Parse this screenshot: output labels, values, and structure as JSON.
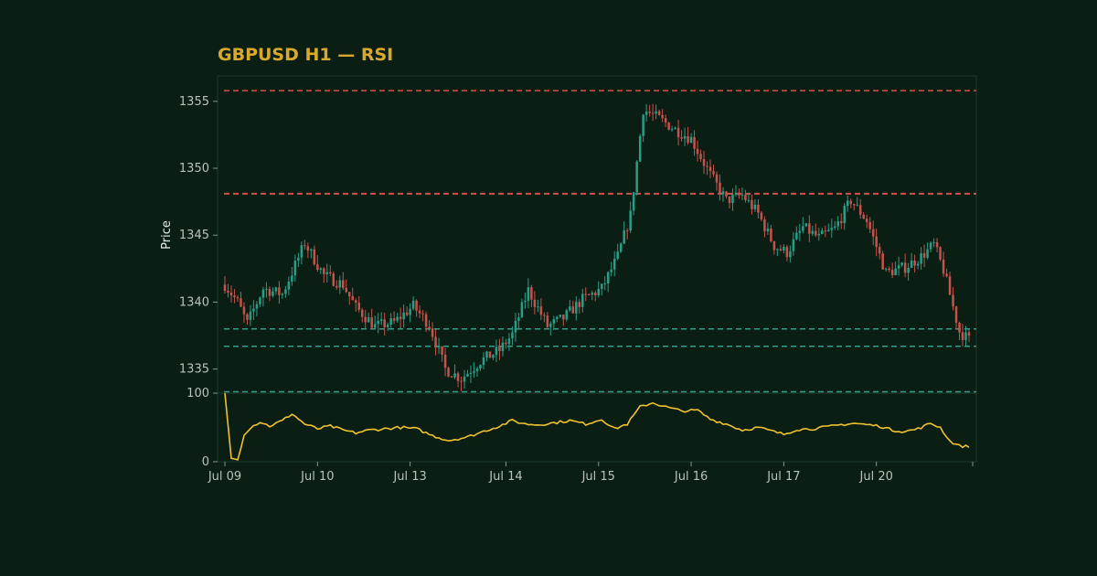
{
  "chart_data": {
    "type": "candlestick",
    "title": "GBPUSD H1 — RSI",
    "price_panel": {
      "ylabel": "Price",
      "yticks": [
        1335,
        1340,
        1345,
        1350,
        1355
      ],
      "ylim": [
        1333.2,
        1356.9
      ],
      "resistance_levels": [
        1355.8,
        1348.1
      ],
      "support_levels": [
        1338.0,
        1336.7,
        1333.3
      ],
      "series_anchors": [
        [
          0,
          1341.3
        ],
        [
          4,
          1340.0
        ],
        [
          7,
          1338.4
        ],
        [
          12,
          1341.0
        ],
        [
          18,
          1340.6
        ],
        [
          25,
          1344.4
        ],
        [
          31,
          1342.0
        ],
        [
          37,
          1341.3
        ],
        [
          41,
          1339.6
        ],
        [
          47,
          1338.2
        ],
        [
          53,
          1338.5
        ],
        [
          59,
          1339.7
        ],
        [
          64,
          1338.3
        ],
        [
          69,
          1335.0
        ],
        [
          74,
          1334.3
        ],
        [
          80,
          1335.6
        ],
        [
          86,
          1336.4
        ],
        [
          90,
          1337.6
        ],
        [
          95,
          1340.9
        ],
        [
          101,
          1338.2
        ],
        [
          106,
          1338.8
        ],
        [
          112,
          1340.2
        ],
        [
          118,
          1341.0
        ],
        [
          123,
          1343.4
        ],
        [
          127,
          1346.5
        ],
        [
          131,
          1354.4
        ],
        [
          136,
          1353.7
        ],
        [
          141,
          1352.9
        ],
        [
          146,
          1352.2
        ],
        [
          152,
          1349.5
        ],
        [
          157,
          1347.6
        ],
        [
          162,
          1348.0
        ],
        [
          167,
          1346.6
        ],
        [
          172,
          1344.2
        ],
        [
          176,
          1343.7
        ],
        [
          181,
          1345.6
        ],
        [
          186,
          1344.8
        ],
        [
          191,
          1345.5
        ],
        [
          196,
          1347.6
        ],
        [
          201,
          1346.1
        ],
        [
          207,
          1342.2
        ],
        [
          213,
          1342.6
        ],
        [
          218,
          1343.4
        ],
        [
          222,
          1344.3
        ],
        [
          225,
          1342.4
        ],
        [
          230,
          1337.8
        ],
        [
          233,
          1337.2
        ]
      ]
    },
    "rsi_panel": {
      "yticks": [
        0,
        100
      ],
      "ylim": [
        0,
        100
      ],
      "series_anchors": [
        [
          0,
          100
        ],
        [
          2,
          5
        ],
        [
          4,
          3
        ],
        [
          6,
          40
        ],
        [
          8,
          50
        ],
        [
          11,
          58
        ],
        [
          14,
          52
        ],
        [
          18,
          60
        ],
        [
          21,
          70
        ],
        [
          25,
          55
        ],
        [
          29,
          48
        ],
        [
          33,
          52
        ],
        [
          37,
          46
        ],
        [
          41,
          42
        ],
        [
          45,
          46
        ],
        [
          50,
          48
        ],
        [
          55,
          50
        ],
        [
          60,
          48
        ],
        [
          65,
          38
        ],
        [
          70,
          31
        ],
        [
          76,
          36
        ],
        [
          82,
          46
        ],
        [
          86,
          52
        ],
        [
          90,
          60
        ],
        [
          94,
          55
        ],
        [
          98,
          54
        ],
        [
          102,
          56
        ],
        [
          108,
          60
        ],
        [
          113,
          55
        ],
        [
          118,
          62
        ],
        [
          122,
          48
        ],
        [
          126,
          55
        ],
        [
          130,
          80
        ],
        [
          134,
          86
        ],
        [
          138,
          80
        ],
        [
          143,
          74
        ],
        [
          148,
          75
        ],
        [
          152,
          62
        ],
        [
          157,
          55
        ],
        [
          162,
          46
        ],
        [
          167,
          50
        ],
        [
          171,
          45
        ],
        [
          175,
          40
        ],
        [
          179,
          47
        ],
        [
          184,
          48
        ],
        [
          189,
          51
        ],
        [
          193,
          54
        ],
        [
          197,
          56
        ],
        [
          201,
          54
        ],
        [
          205,
          52
        ],
        [
          209,
          46
        ],
        [
          213,
          44
        ],
        [
          217,
          48
        ],
        [
          221,
          56
        ],
        [
          224,
          50
        ],
        [
          227,
          30
        ],
        [
          230,
          23
        ],
        [
          233,
          22
        ]
      ]
    },
    "x_axis": {
      "tick_labels": [
        "Jul 09",
        "Jul 10",
        "Jul 13",
        "Jul 14",
        "Jul 15",
        "Jul 16",
        "Jul 17",
        "Jul 20"
      ],
      "tick_bar_index": [
        0,
        29,
        58,
        88,
        117,
        146,
        175,
        204
      ]
    },
    "colors": {
      "background": "#0b1e14",
      "up": "#2a9d86",
      "down": "#c7524b",
      "rsi_line": "#f0c230",
      "title": "#d9a92e",
      "resistance": "#d4504b",
      "support": "#2f9f8c",
      "frame": "#1f3a2c"
    },
    "grid": false,
    "n_bars": 234
  }
}
